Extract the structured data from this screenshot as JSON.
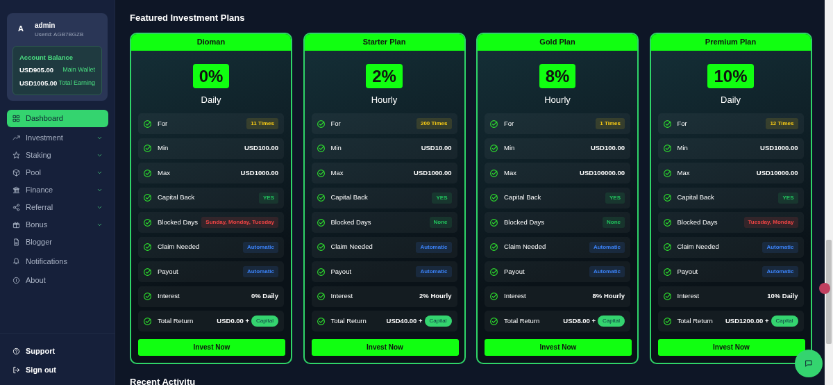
{
  "user": {
    "avatar": "A",
    "name": "admin",
    "userid": "Userid: AGB7BGZB"
  },
  "balance": {
    "title": "Account Balance",
    "lines": [
      {
        "amount": "USD905.00",
        "label": "Main Wallet"
      },
      {
        "amount": "USD1005.00",
        "label": "Total Earning"
      }
    ]
  },
  "sidebar": {
    "items": [
      {
        "label": "Dashboard",
        "selected": true,
        "expandable": false
      },
      {
        "label": "Investment",
        "selected": false,
        "expandable": true
      },
      {
        "label": "Staking",
        "selected": false,
        "expandable": true
      },
      {
        "label": "Pool",
        "selected": false,
        "expandable": true
      },
      {
        "label": "Finance",
        "selected": false,
        "expandable": true
      },
      {
        "label": "Referral",
        "selected": false,
        "expandable": true
      },
      {
        "label": "Bonus",
        "selected": false,
        "expandable": true
      },
      {
        "label": "Blogger",
        "selected": false,
        "expandable": false
      },
      {
        "label": "Notifications",
        "selected": false,
        "expandable": false
      },
      {
        "label": "About",
        "selected": false,
        "expandable": false
      }
    ],
    "footer": [
      "Support",
      "Sign out"
    ]
  },
  "section_title": "Featured Investment Plans",
  "plans": [
    {
      "name": "Dioman",
      "rate": "0%",
      "period": "Daily",
      "button": "Invest Now",
      "rows": [
        {
          "label": "For",
          "kind": "tag",
          "value": "11 Times",
          "color": "#facc15"
        },
        {
          "label": "Min",
          "kind": "amount",
          "value": "USD100.00"
        },
        {
          "label": "Max",
          "kind": "amount",
          "value": "USD1000.00"
        },
        {
          "label": "Capital Back",
          "kind": "tag",
          "value": "YES",
          "color": "#22c55e"
        },
        {
          "label": "Blocked Days",
          "kind": "tag",
          "value": "Sunday, Monday, Tuesday",
          "color": "#ef4444"
        },
        {
          "label": "Claim Needed",
          "kind": "tag",
          "value": "Automatic",
          "color": "#3b82f6"
        },
        {
          "label": "Payout",
          "kind": "tag",
          "value": "Automatic",
          "color": "#3b82f6"
        },
        {
          "label": "Interest",
          "kind": "amount",
          "value": "0% Daily"
        },
        {
          "label": "Total Return",
          "kind": "total",
          "value": "USD0.00 +",
          "tag": "Capital"
        }
      ]
    },
    {
      "name": "Starter Plan",
      "rate": "2%",
      "period": "Hourly",
      "button": "Invest Now",
      "rows": [
        {
          "label": "For",
          "kind": "tag",
          "value": "200 Times",
          "color": "#facc15"
        },
        {
          "label": "Min",
          "kind": "amount",
          "value": "USD10.00"
        },
        {
          "label": "Max",
          "kind": "amount",
          "value": "USD1000.00"
        },
        {
          "label": "Capital Back",
          "kind": "tag",
          "value": "YES",
          "color": "#22c55e"
        },
        {
          "label": "Blocked Days",
          "kind": "tag",
          "value": "None",
          "color": "#22c55e"
        },
        {
          "label": "Claim Needed",
          "kind": "tag",
          "value": "Automatic",
          "color": "#3b82f6"
        },
        {
          "label": "Payout",
          "kind": "tag",
          "value": "Automatic",
          "color": "#3b82f6"
        },
        {
          "label": "Interest",
          "kind": "amount",
          "value": "2% Hourly"
        },
        {
          "label": "Total Return",
          "kind": "total",
          "value": "USD40.00 +",
          "tag": "Capital"
        }
      ]
    },
    {
      "name": "Gold Plan",
      "rate": "8%",
      "period": "Hourly",
      "button": "Invest Now",
      "rows": [
        {
          "label": "For",
          "kind": "tag",
          "value": "1 Times",
          "color": "#facc15"
        },
        {
          "label": "Min",
          "kind": "amount",
          "value": "USD100.00"
        },
        {
          "label": "Max",
          "kind": "amount",
          "value": "USD100000.00"
        },
        {
          "label": "Capital Back",
          "kind": "tag",
          "value": "YES",
          "color": "#22c55e"
        },
        {
          "label": "Blocked Days",
          "kind": "tag",
          "value": "None",
          "color": "#22c55e"
        },
        {
          "label": "Claim Needed",
          "kind": "tag",
          "value": "Automatic",
          "color": "#3b82f6"
        },
        {
          "label": "Payout",
          "kind": "tag",
          "value": "Automatic",
          "color": "#3b82f6"
        },
        {
          "label": "Interest",
          "kind": "amount",
          "value": "8% Hourly"
        },
        {
          "label": "Total Return",
          "kind": "total",
          "value": "USD8.00 +",
          "tag": "Capital"
        }
      ]
    },
    {
      "name": "Premium Plan",
      "rate": "10%",
      "period": "Daily",
      "button": "Invest Now",
      "rows": [
        {
          "label": "For",
          "kind": "tag",
          "value": "12 Times",
          "color": "#facc15"
        },
        {
          "label": "Min",
          "kind": "amount",
          "value": "USD1000.00"
        },
        {
          "label": "Max",
          "kind": "amount",
          "value": "USD10000.00"
        },
        {
          "label": "Capital Back",
          "kind": "tag",
          "value": "YES",
          "color": "#22c55e"
        },
        {
          "label": "Blocked Days",
          "kind": "tag",
          "value": "Tuesday, Monday",
          "color": "#ef4444"
        },
        {
          "label": "Claim Needed",
          "kind": "tag",
          "value": "Automatic",
          "color": "#3b82f6"
        },
        {
          "label": "Payout",
          "kind": "tag",
          "value": "Automatic",
          "color": "#3b82f6"
        },
        {
          "label": "Interest",
          "kind": "amount",
          "value": "10% Daily"
        },
        {
          "label": "Total Return",
          "kind": "total",
          "value": "USD1200.00 +",
          "tag": "Capital"
        }
      ]
    }
  ],
  "next_section_title": "Recent Activitu"
}
